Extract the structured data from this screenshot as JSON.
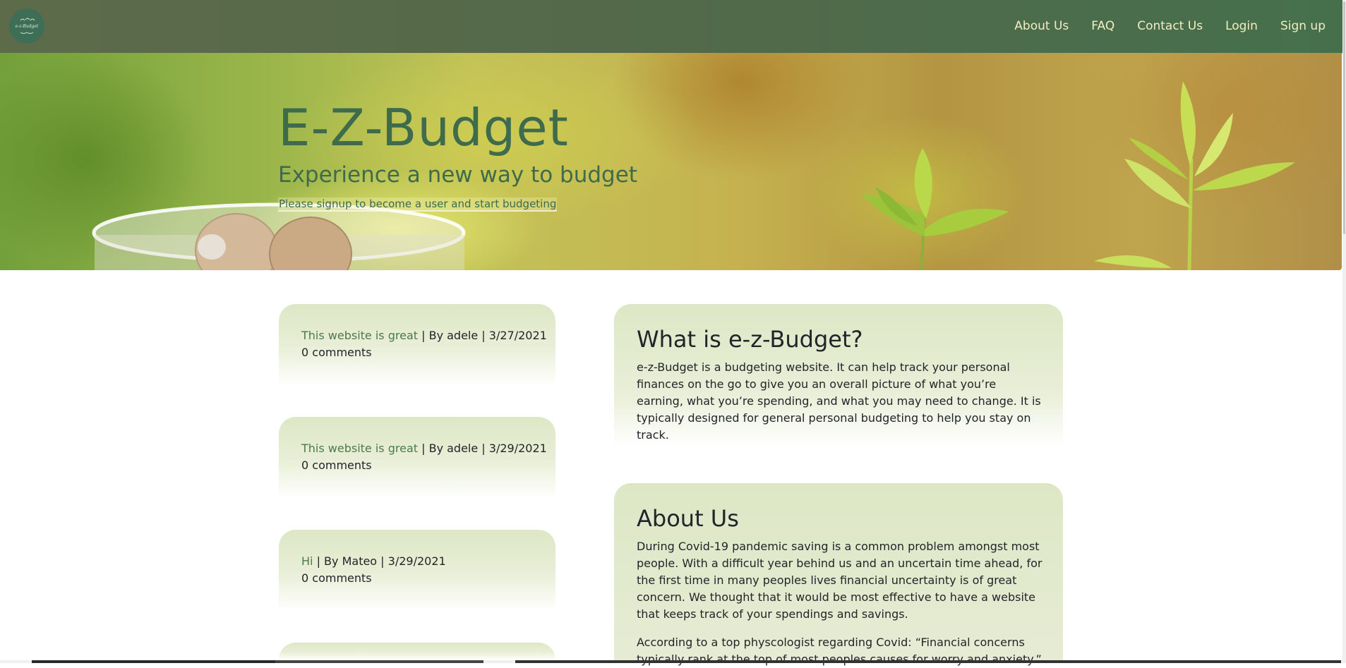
{
  "brand": {
    "logo_text": "e-z-Budget"
  },
  "nav": {
    "items": [
      {
        "label": "About Us"
      },
      {
        "label": "FAQ"
      },
      {
        "label": "Contact Us"
      },
      {
        "label": "Login"
      },
      {
        "label": "Sign up"
      }
    ]
  },
  "hero": {
    "title": "E-Z-Budget",
    "subtitle": "Experience a new way to budget",
    "note": "Please signup to become a user and start budgeting"
  },
  "posts": [
    {
      "title": "This website is great",
      "meta": " | By adele | 3/27/2021",
      "comments": "0 comments"
    },
    {
      "title": "This website is great",
      "meta": " | By adele | 3/29/2021",
      "comments": "0 comments"
    },
    {
      "title": "Hi",
      "meta": " | By Mateo | 3/29/2021",
      "comments": "0 comments"
    }
  ],
  "what_is": {
    "heading": "What is e-z-Budget?",
    "body": "e-z-Budget is a budgeting website. It can help track your personal finances on the go to give you an overall picture of what you’re earning, what you’re spending, and what you may need to change. It is typically designed for general personal budgeting to help you stay on track."
  },
  "about": {
    "heading": "About Us",
    "body1": "During Covid-19 pandemic saving is a common problem amongst most people. With a difficult year behind us and an uncertain time ahead, for the first time in many peoples lives financial uncertainty is of great concern. We thought that it would be most effective to have a website that keeps track of your spendings and savings.",
    "body2": "According to a top physcologist regarding Covid: “Financial concerns typically rank at the top of most peoples causes for worry and anxiety.”"
  },
  "colors": {
    "navbar": "#52694a",
    "nav_text": "#f1edc4",
    "hero_text": "#3e6b4c",
    "card_top": "#dde7c5",
    "post_link": "#4b7a4f"
  }
}
